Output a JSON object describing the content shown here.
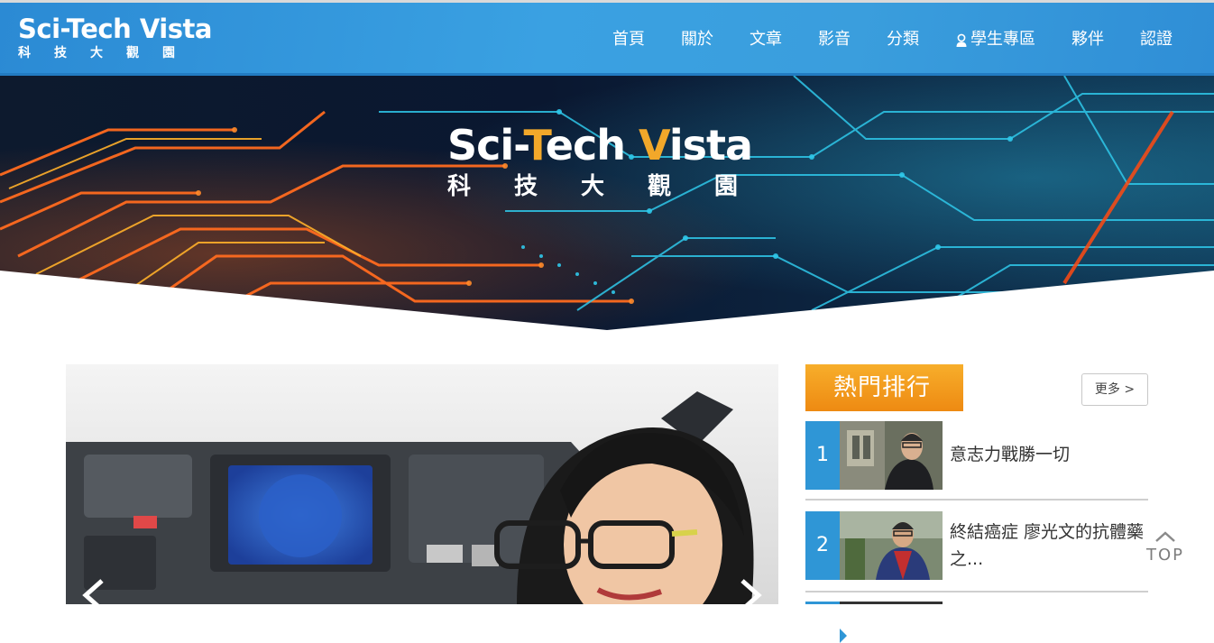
{
  "header": {
    "logo_en": "Sci-Tech Vista",
    "logo_zh": "科技大觀園",
    "nav": [
      "首頁",
      "關於",
      "文章",
      "影音",
      "分類",
      "學生專區",
      "夥伴",
      "認證"
    ]
  },
  "banner": {
    "title_en_prefix": "Sci-",
    "title_en_t": "T",
    "title_en_mid": "ech ",
    "title_en_v": "V",
    "title_en_suffix": "ista",
    "title_zh": "科技大觀園"
  },
  "sidebar": {
    "hot_title": "熱門排行",
    "more_label": "更多 >",
    "items": [
      {
        "rank": "1",
        "title": "意志力戰勝一切"
      },
      {
        "rank": "2",
        "title": "終結癌症 廖光文的抗體藥之..."
      }
    ]
  },
  "top_button": {
    "label": "TOP"
  },
  "colors": {
    "header_blue": "#3a9edd",
    "hot_orange": "#f29a1d",
    "rank_blue": "#2f96d6",
    "accent_gold": "#f2a82a"
  }
}
